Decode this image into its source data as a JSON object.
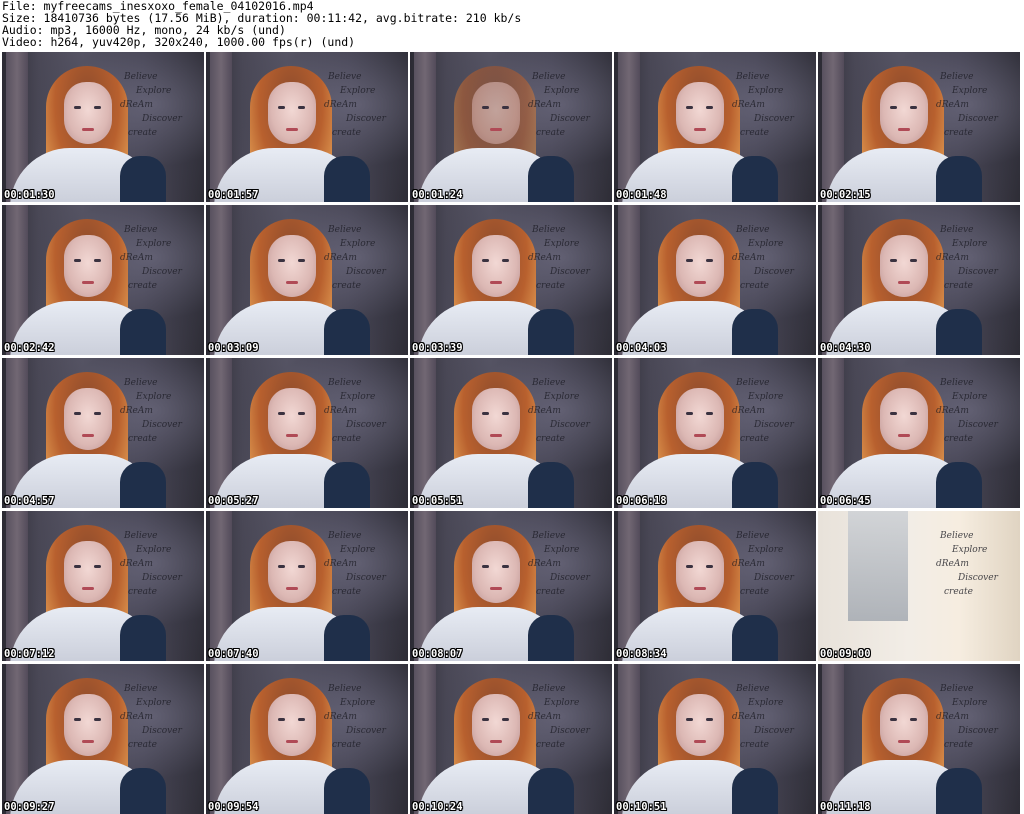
{
  "header": {
    "file": "File: myfreecams_inesxoxo_female_04102016.mp4",
    "size": "Size: 18410736 bytes (17.56 MiB), duration: 00:11:42, avg.bitrate: 210 kb/s",
    "audio": "Audio: mp3, 16000 Hz, mono, 24 kb/s (und)",
    "video": "Video: h264, yuv420p, 320x240, 1000.00 fps(r) (und)"
  },
  "decoration_text": {
    "line1": "Believe",
    "line2": "Explore",
    "line3": "dReAm",
    "line4": "Discover",
    "line5": "create"
  },
  "thumbnails": [
    {
      "timestamp": "00:01:30",
      "style": "normal"
    },
    {
      "timestamp": "00:01:57",
      "style": "normal"
    },
    {
      "timestamp": "00:01:24",
      "style": "blurred"
    },
    {
      "timestamp": "00:01:48",
      "style": "normal"
    },
    {
      "timestamp": "00:02:15",
      "style": "normal"
    },
    {
      "timestamp": "00:02:42",
      "style": "normal"
    },
    {
      "timestamp": "00:03:09",
      "style": "normal"
    },
    {
      "timestamp": "00:03:39",
      "style": "normal"
    },
    {
      "timestamp": "00:04:03",
      "style": "normal"
    },
    {
      "timestamp": "00:04:30",
      "style": "normal"
    },
    {
      "timestamp": "00:04:57",
      "style": "normal"
    },
    {
      "timestamp": "00:05:27",
      "style": "normal"
    },
    {
      "timestamp": "00:05:51",
      "style": "normal"
    },
    {
      "timestamp": "00:06:18",
      "style": "normal"
    },
    {
      "timestamp": "00:06:45",
      "style": "normal"
    },
    {
      "timestamp": "00:07:12",
      "style": "normal"
    },
    {
      "timestamp": "00:07:40",
      "style": "normal"
    },
    {
      "timestamp": "00:08:07",
      "style": "normal"
    },
    {
      "timestamp": "00:08:34",
      "style": "normal"
    },
    {
      "timestamp": "00:09:00",
      "style": "bright"
    },
    {
      "timestamp": "00:09:27",
      "style": "normal"
    },
    {
      "timestamp": "00:09:54",
      "style": "normal"
    },
    {
      "timestamp": "00:10:24",
      "style": "normal"
    },
    {
      "timestamp": "00:10:51",
      "style": "normal"
    },
    {
      "timestamp": "00:11:18",
      "style": "normal"
    }
  ]
}
